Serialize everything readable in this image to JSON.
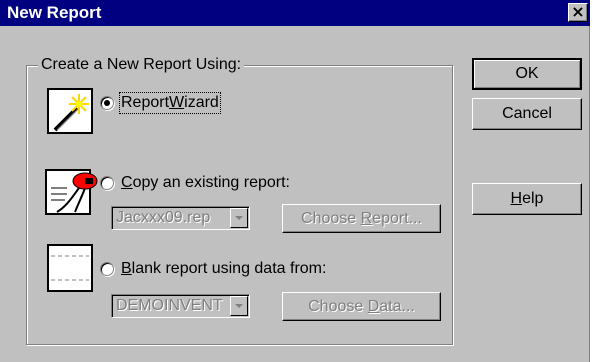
{
  "window": {
    "title": "New Report",
    "close_glyph": "×"
  },
  "group": {
    "label": "Create a New Report Using:"
  },
  "options": {
    "wizard": {
      "label_pre": "Report",
      "label_u": "W",
      "label_post": "izard",
      "selected": true,
      "icon": "magic-wand-icon"
    },
    "copy": {
      "label_pre": "",
      "label_u": "C",
      "label_post": "opy an existing report:",
      "selected": false,
      "icon": "report-copy-icon",
      "combo_value": "Jacxxx09.rep",
      "button_pre": "Choose ",
      "button_u": "R",
      "button_post": "eport..."
    },
    "blank": {
      "label_pre": "",
      "label_u": "B",
      "label_post": "lank report using data from:",
      "selected": false,
      "icon": "blank-page-icon",
      "combo_value": "DEMOINVENT",
      "button_pre": "Choose ",
      "button_u": "D",
      "button_post": "ata..."
    }
  },
  "buttons": {
    "ok": "OK",
    "cancel": "Cancel",
    "help_u": "H",
    "help_post": "elp"
  }
}
